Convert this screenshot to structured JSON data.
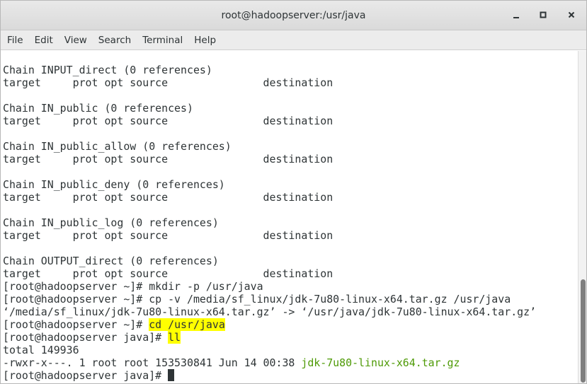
{
  "window": {
    "title": "root@hadoopserver:/usr/java",
    "controls": {
      "minimize": "minimize-icon",
      "maximize": "maximize-icon",
      "close": "close-icon"
    }
  },
  "menu": [
    "File",
    "Edit",
    "View",
    "Search",
    "Terminal",
    "Help"
  ],
  "terminal": {
    "lines": [
      [
        {
          "text": "Chain INPUT_direct (0 references)"
        }
      ],
      [
        {
          "text": "target     prot opt source               destination"
        }
      ],
      [
        {
          "text": ""
        }
      ],
      [
        {
          "text": "Chain IN_public (0 references)"
        }
      ],
      [
        {
          "text": "target     prot opt source               destination"
        }
      ],
      [
        {
          "text": ""
        }
      ],
      [
        {
          "text": "Chain IN_public_allow (0 references)"
        }
      ],
      [
        {
          "text": "target     prot opt source               destination"
        }
      ],
      [
        {
          "text": ""
        }
      ],
      [
        {
          "text": "Chain IN_public_deny (0 references)"
        }
      ],
      [
        {
          "text": "target     prot opt source               destination"
        }
      ],
      [
        {
          "text": ""
        }
      ],
      [
        {
          "text": "Chain IN_public_log (0 references)"
        }
      ],
      [
        {
          "text": "target     prot opt source               destination"
        }
      ],
      [
        {
          "text": ""
        }
      ],
      [
        {
          "text": "Chain OUTPUT_direct (0 references)"
        }
      ],
      [
        {
          "text": "target     prot opt source               destination"
        }
      ],
      [
        {
          "text": "[root@hadoopserver ~]# mkdir -p /usr/java"
        }
      ],
      [
        {
          "text": "[root@hadoopserver ~]# cp -v /media/sf_linux/jdk-7u80-linux-x64.tar.gz /usr/java"
        }
      ],
      [
        {
          "text": "‘/media/sf_linux/jdk-7u80-linux-x64.tar.gz’ -> ‘/usr/java/jdk-7u80-linux-x64.tar.gz’"
        }
      ],
      [
        {
          "text": "[root@hadoopserver ~]# "
        },
        {
          "text": "cd /usr/java",
          "style": "highlight"
        }
      ],
      [
        {
          "text": "[root@hadoopserver java]# "
        },
        {
          "text": "ll",
          "style": "highlight"
        }
      ],
      [
        {
          "text": "total 149936"
        }
      ],
      [
        {
          "text": "-rwxr-x---. 1 root root 153530841 Jun 14 00:38 "
        },
        {
          "text": "jdk-7u80-linux-x64.tar.gz",
          "style": "green"
        }
      ],
      [
        {
          "text": "[root@hadoopserver java]# "
        },
        {
          "style": "cursor"
        }
      ]
    ]
  },
  "scrollbar": {
    "thumb_start": 0.685,
    "thumb_end": 1.0
  },
  "colors": {
    "highlight": "#ffff00",
    "file_green": "#4e9a06",
    "text": "#2e3436",
    "background": "#ffffff"
  }
}
